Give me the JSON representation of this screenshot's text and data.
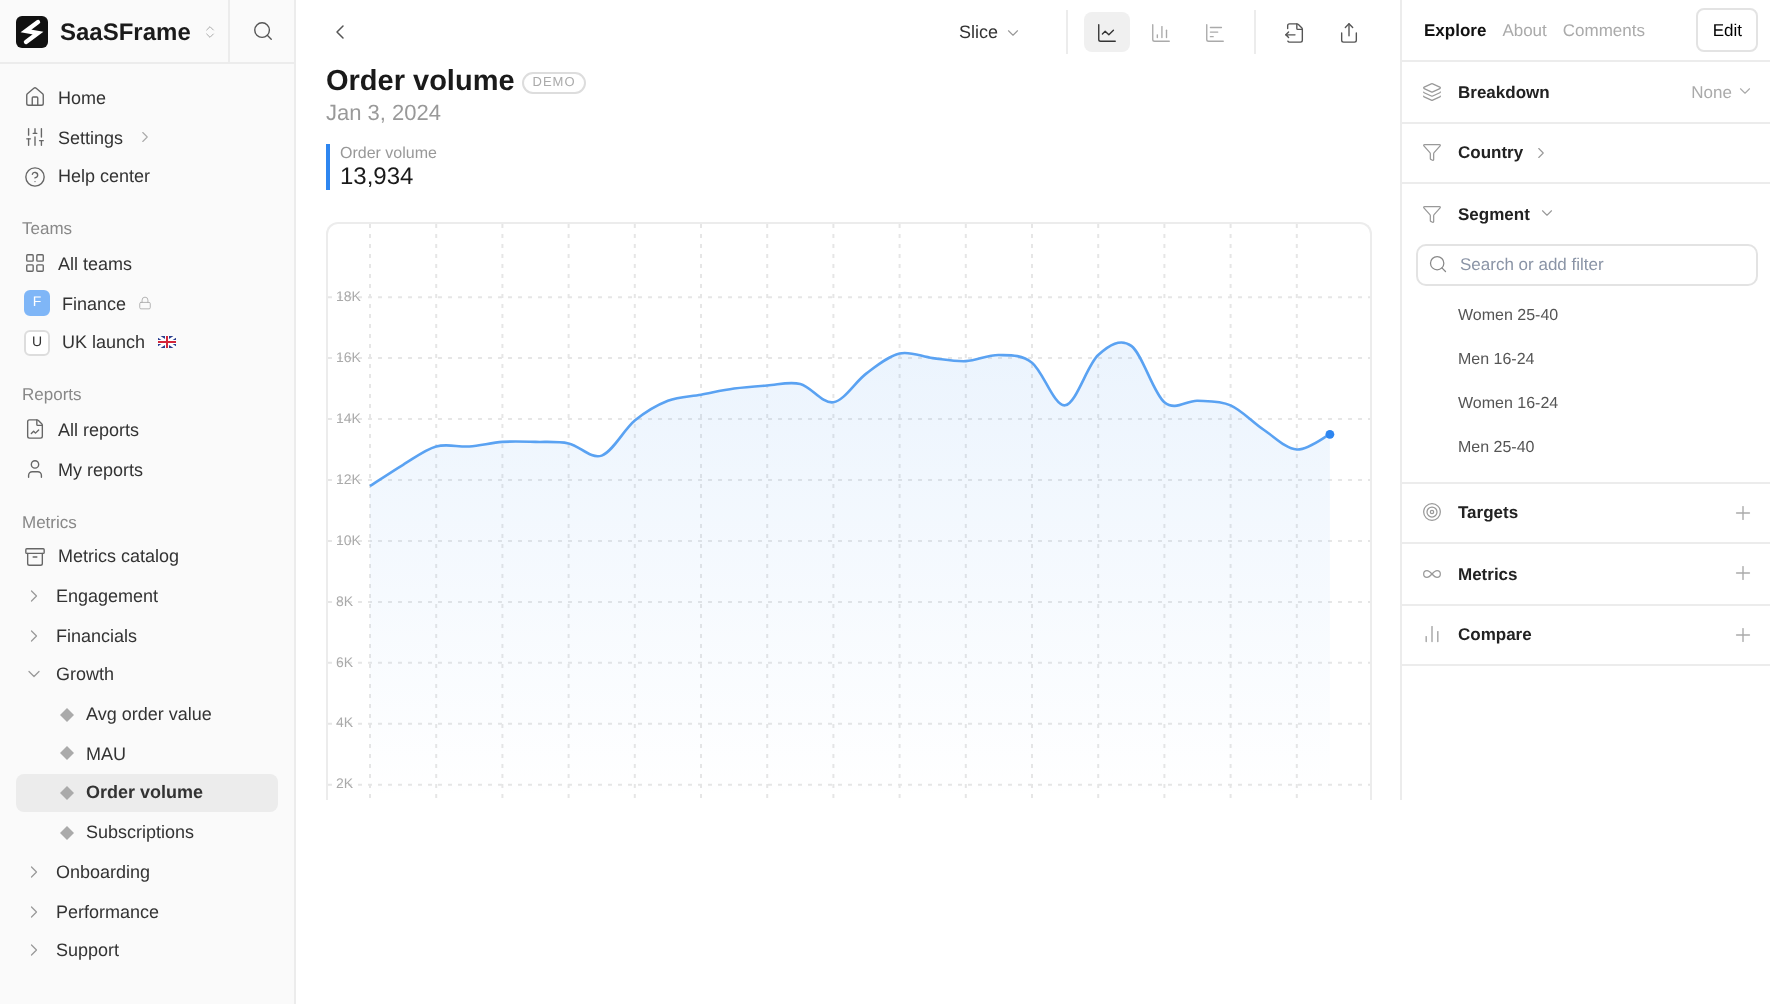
{
  "sidebar": {
    "workspace": "SaaSFrame",
    "nav": [
      {
        "label": "Home",
        "kind": "link"
      },
      {
        "label": "Settings",
        "kind": "submenu"
      },
      {
        "label": "Help center",
        "kind": "link"
      }
    ],
    "sections": [
      {
        "title": "Teams",
        "items": [
          {
            "label": "All teams",
            "kind": "link"
          },
          {
            "label": "Finance",
            "kind": "team",
            "avatar": "F",
            "color": "#7fb6f7"
          },
          {
            "label": "UK launch",
            "kind": "team",
            "avatar": "U",
            "color": "#ffffff"
          }
        ]
      },
      {
        "title": "Reports",
        "items": [
          {
            "label": "All reports",
            "kind": "link"
          },
          {
            "label": "My reports",
            "kind": "link"
          }
        ]
      },
      {
        "title": "Metrics",
        "items": [
          {
            "label": "Metrics catalog",
            "kind": "link"
          },
          {
            "label": "Engagement",
            "kind": "group",
            "expanded": false
          },
          {
            "label": "Financials",
            "kind": "group",
            "expanded": false
          },
          {
            "label": "Growth",
            "kind": "group",
            "expanded": true,
            "children": [
              {
                "label": "Avg order value",
                "selected": false
              },
              {
                "label": "MAU",
                "selected": false
              },
              {
                "label": "Order volume",
                "selected": true
              },
              {
                "label": "Subscriptions",
                "selected": false
              }
            ]
          },
          {
            "label": "Onboarding",
            "kind": "group",
            "expanded": false
          },
          {
            "label": "Performance",
            "kind": "group",
            "expanded": false
          },
          {
            "label": "Support",
            "kind": "group",
            "expanded": false
          }
        ]
      }
    ]
  },
  "toolbar": {
    "slice": "Slice",
    "views": [
      {
        "selected": true
      },
      {
        "selected": false
      },
      {
        "selected": false
      }
    ]
  },
  "header": {
    "title": "Order volume",
    "badge": "DEMO",
    "date": "Jan 3, 2024"
  },
  "metric": {
    "label": "Order volume",
    "value": "13,934"
  },
  "chart": {
    "chart_data": {
      "type": "area",
      "grid": true,
      "series": [
        {
          "color": "#5aa2f2",
          "values": [
            11800,
            12500,
            13100,
            13100,
            13250,
            13250,
            13200,
            12800,
            13950,
            14600,
            14800,
            15000,
            15100,
            15150,
            14550,
            15500,
            16150,
            16000,
            15900,
            16100,
            15850,
            14450,
            16100,
            16400,
            14550,
            14600,
            14450,
            13650,
            13000,
            13500
          ]
        }
      ],
      "ylim": [
        1500,
        20400
      ],
      "yticks": [
        {
          "value": 2000,
          "label": "2K"
        },
        {
          "value": 4000,
          "label": "4K"
        },
        {
          "value": 6000,
          "label": "6K"
        },
        {
          "value": 8000,
          "label": "8K"
        },
        {
          "value": 10000,
          "label": "10K"
        },
        {
          "value": 12000,
          "label": "12K"
        },
        {
          "value": 14000,
          "label": "14K"
        },
        {
          "value": 16000,
          "label": "16K"
        },
        {
          "value": 18000,
          "label": "18K"
        }
      ]
    }
  },
  "panel": {
    "tabs": [
      {
        "label": "Explore",
        "selected": true
      },
      {
        "label": "About",
        "selected": false
      },
      {
        "label": "Comments",
        "selected": false
      }
    ],
    "edit": "Edit",
    "sections": [
      {
        "label": "Breakdown",
        "kind": "select",
        "value": "None"
      },
      {
        "label": "Country",
        "kind": "filter",
        "expanded": false
      },
      {
        "label": "Segment",
        "kind": "filter",
        "expanded": true,
        "placeholder": "Search or add filter",
        "options": [
          "Women 25-40",
          "Men 16-24",
          "Women 16-24",
          "Men 25-40"
        ]
      },
      {
        "label": "Targets",
        "kind": "add"
      },
      {
        "label": "Metrics",
        "kind": "add"
      },
      {
        "label": "Compare",
        "kind": "add"
      }
    ]
  }
}
